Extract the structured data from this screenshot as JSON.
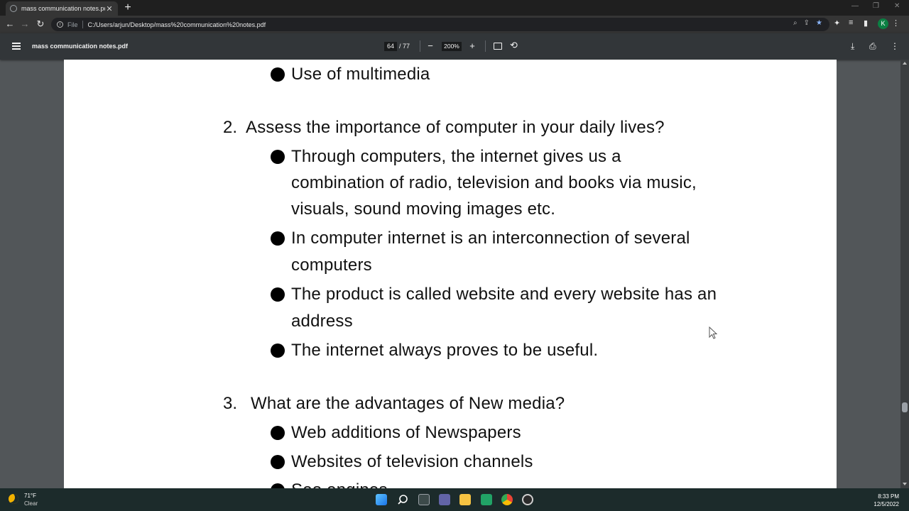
{
  "browser": {
    "tab_title": "mass communication notes.pdf",
    "tab_close": "✕",
    "new_tab": "+",
    "address_scheme": "File",
    "address_url": "C:/Users/arjun/Desktop/mass%20communication%20notes.pdf",
    "profile_initial": "K"
  },
  "pdf_toolbar": {
    "file_name": "mass communication notes.pdf",
    "current_page": "64",
    "total_pages": "/ 77",
    "zoom_level": "200%",
    "zoom_out": "−",
    "zoom_in": "+"
  },
  "document": {
    "lines": [
      {
        "text": "Use of multimedia",
        "bullet": true
      },
      {
        "num": "2.",
        "text": "Assess the importance of computer in your daily lives?"
      },
      {
        "text": "Through computers, the internet gives us a",
        "bullet": true
      },
      {
        "text": "combination of radio, television and books via music,"
      },
      {
        "text": "visuals, sound moving images etc."
      },
      {
        "text": "In computer internet is an interconnection of several",
        "bullet": true
      },
      {
        "text": "computers"
      },
      {
        "text": "The product is called website and every website has an",
        "bullet": true
      },
      {
        "text": "address"
      },
      {
        "text": "The internet always proves to be useful.",
        "bullet": true
      },
      {
        "num": "3.",
        "text": "What  are the advantages of New media?"
      },
      {
        "text": " Web additions of Newspapers",
        "bullet": true
      },
      {
        "text": "Websites of television channels",
        "bullet": true
      },
      {
        "text": "Seo engines",
        "bullet": true
      }
    ]
  },
  "taskbar": {
    "temperature": "71°F",
    "weather": "Clear",
    "time": "8:33 PM",
    "date": "12/5/2022"
  },
  "colors": {
    "pdf_background": "#525659",
    "pdf_toolbar": "#323639",
    "taskbar": "#1c2b2b",
    "accent": "#8ab4f8"
  }
}
